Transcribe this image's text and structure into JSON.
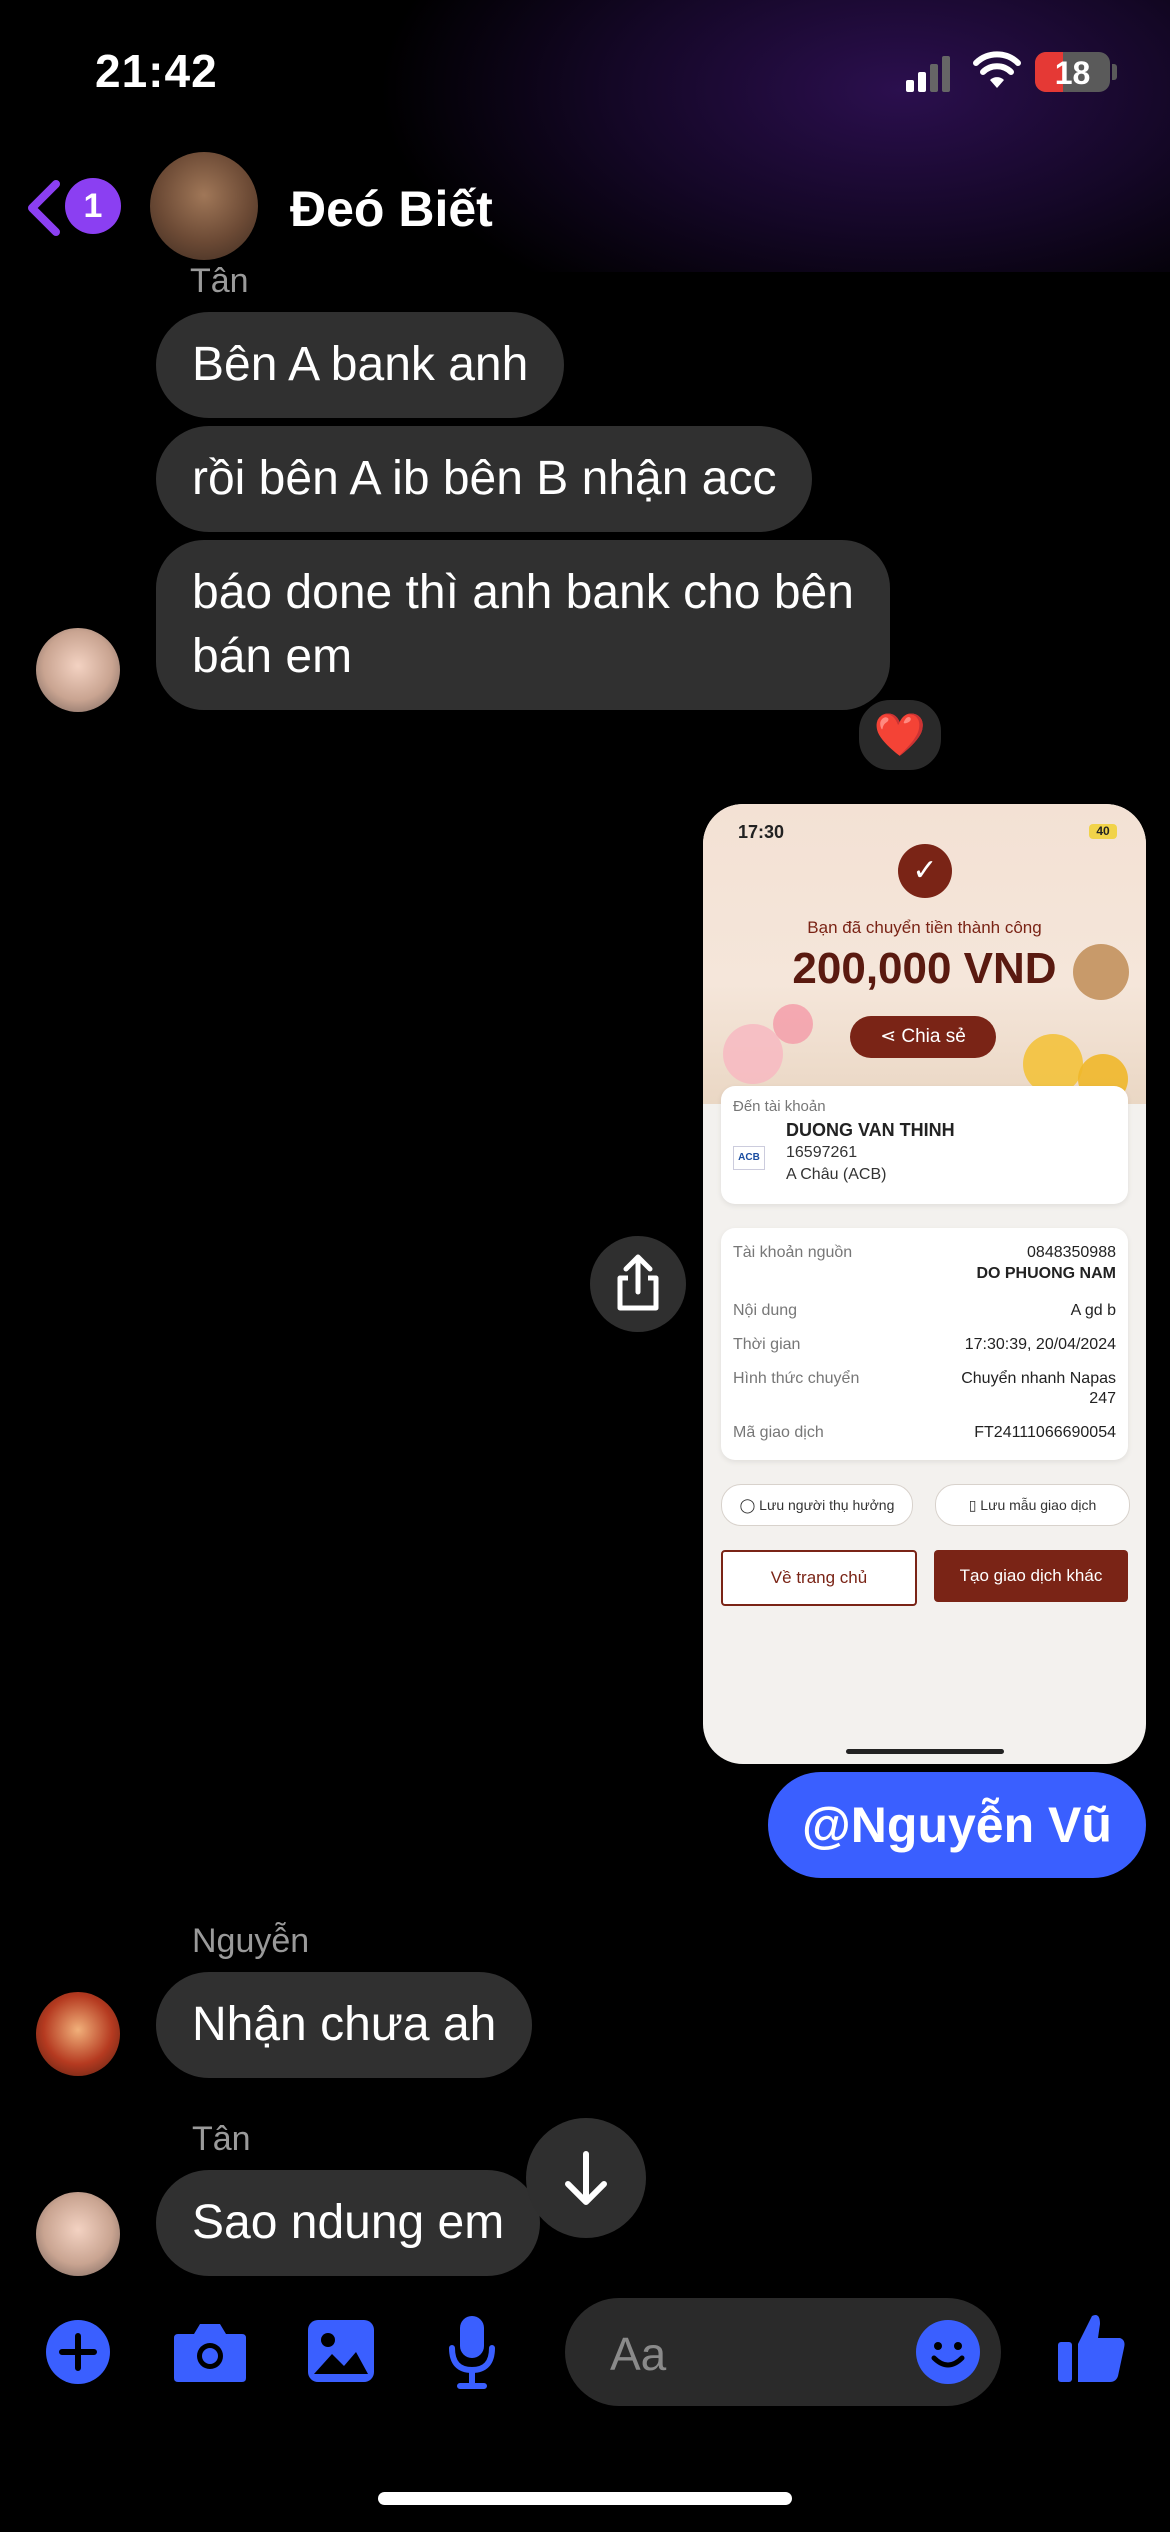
{
  "status_bar": {
    "time": "21:42",
    "battery": "18"
  },
  "nav": {
    "back_badge": "1",
    "contact_name": "Đeó Biết"
  },
  "messages": [
    {
      "sender": "Tân",
      "texts": [
        "Bên A bank anh",
        "rồi bên A ib bên B nhận acc",
        "báo done thì anh bank cho bên",
        "bán em"
      ],
      "reaction": "❤️"
    },
    {
      "sender": "Nguyễn",
      "texts": [
        "Nhận chưa ah"
      ]
    },
    {
      "sender": "Tân",
      "texts": [
        "Sao ndung em"
      ]
    }
  ],
  "own_message": {
    "text": "@Nguyễn Vũ"
  },
  "receipt": {
    "time": "17:30",
    "battery": "40",
    "success_text": "Bạn đã chuyển tiền thành công",
    "amount": "200,000 VND",
    "share_label": "Chia sẻ",
    "to_account_label": "Đến tài khoản",
    "bank_logo": "ACB",
    "recipient_name": "DUONG VAN THINH",
    "recipient_account": "16597261",
    "recipient_bank": "A Châu (ACB)",
    "rows": [
      {
        "label": "Tài khoản nguồn",
        "value": "0848350988",
        "value2": "DO PHUONG NAM"
      },
      {
        "label": "Nội dung",
        "value": "A gd b"
      },
      {
        "label": "Thời gian",
        "value": "17:30:39, 20/04/2024"
      },
      {
        "label": "Hình thức chuyển",
        "value": "Chuyển nhanh Napas",
        "value2": "247"
      },
      {
        "label": "Mã giao dịch",
        "value": "FT24111066690054"
      }
    ],
    "save_beneficiary": "Lưu người thụ hưởng",
    "save_template": "Lưu mẫu giao dịch",
    "home_button": "Về trang chủ",
    "new_transaction_button": "Tạo giao dịch khác"
  },
  "composer": {
    "placeholder": "Aa"
  },
  "colors": {
    "accent": "#3a5fff",
    "back_purple": "#8b3ff2",
    "bubble_gray": "#303030",
    "receipt_brown": "#7a2416"
  },
  "icons": [
    "back-chevron-icon",
    "plus-icon",
    "camera-icon",
    "image-icon",
    "microphone-icon",
    "emoji-icon",
    "thumbs-up-icon",
    "share-icon",
    "arrow-down-icon"
  ]
}
